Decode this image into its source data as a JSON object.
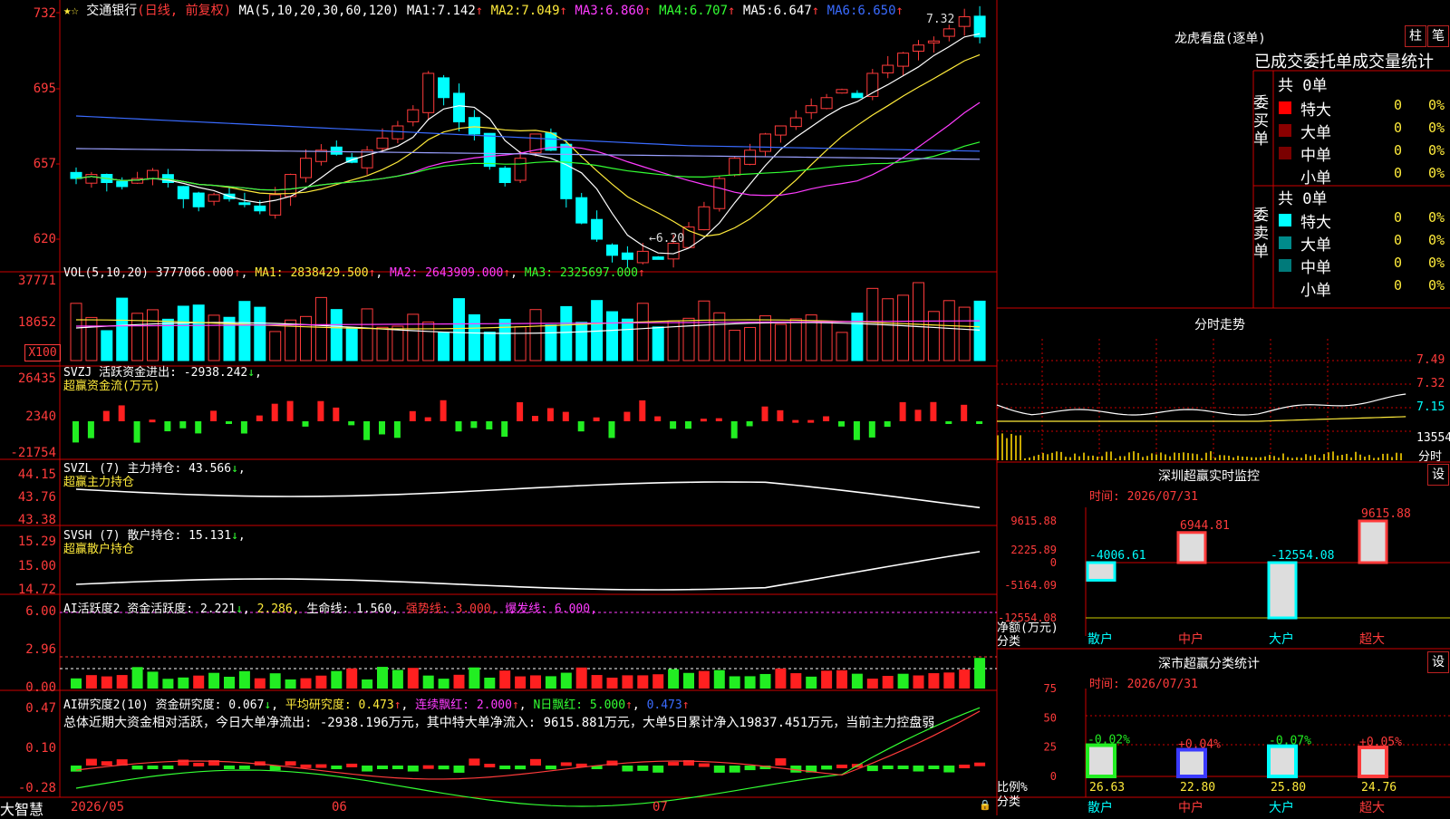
{
  "stock": {
    "name": "交通银行",
    "mode": "(日线, 前复权)"
  },
  "main": {
    "y_ticks": [
      "732",
      "695",
      "657",
      "620"
    ],
    "ma_label": "MA(5,10,20,30,60,120)",
    "ma_values": [
      {
        "label": "MA1:",
        "value": "7.142",
        "arrow": "↑"
      },
      {
        "label": "MA2:",
        "value": "7.049",
        "arrow": "↑"
      },
      {
        "label": "MA3:",
        "value": "6.860",
        "arrow": "↑"
      },
      {
        "label": "MA4:",
        "value": "6.707",
        "arrow": "↑"
      },
      {
        "label": "MA5:",
        "value": "6.647",
        "arrow": "↑"
      },
      {
        "label": "MA6:",
        "value": "6.650",
        "arrow": "↑"
      }
    ],
    "high_label": "7.32",
    "low_label": "←6.20"
  },
  "vol": {
    "y_ticks": [
      "37771",
      "18652"
    ],
    "unit": "X100",
    "label": "VOL(5,10,20)",
    "value": "3777066.000",
    "ma1": "MA1: 2838429.500",
    "ma2": "MA2: 2643909.000",
    "ma3": "MA3: 2325697.000"
  },
  "svzj": {
    "y_ticks": [
      "26435",
      "2340",
      "-21754"
    ],
    "line1": "SVZJ  活跃资金进出: -2938.242",
    "line2": "超赢资金流(万元)"
  },
  "svzl": {
    "y_ticks": [
      "44.15",
      "43.76",
      "43.38"
    ],
    "line1": "SVZL (7) 主力持仓: 43.566",
    "line2": "超赢主力持仓"
  },
  "svsh": {
    "y_ticks": [
      "15.29",
      "15.00",
      "14.72"
    ],
    "line1": "SVSH (7) 散户持仓: 15.131",
    "line2": "超赢散户持仓"
  },
  "ai_active": {
    "y_ticks": [
      "6.00",
      "2.96",
      "0.00"
    ],
    "label": "AI活跃度2 资金活跃度: 2.221",
    "v2": "2.286,",
    "life": "生命线: 1.560,",
    "strong": "强势线: 3.000,",
    "burst": "爆发线: 6.000,"
  },
  "ai_research": {
    "y_ticks": [
      "0.47",
      "0.10",
      "-0.28"
    ],
    "label": "AI研究度2(10) 资金研究度: 0.067",
    "avg": "平均研究度: 0.473",
    "lianxu": "连续飘红: 2.000",
    "nday": "N日飘红: 5.000",
    "last": "0.473",
    "summary": "总体近期大资金相对活跃，今日大单净流出: -2938.196万元，其中特大单净流入: 9615.881万元，大单5日累计净入19837.451万元，当前主力控盘弱"
  },
  "bottom": {
    "brand": "大智慧",
    "dates": [
      "2026/05",
      "06",
      "07"
    ]
  },
  "right": {
    "header_title": "龙虎看盘(逐单)",
    "btn_zhu": "柱",
    "btn_bi": "笔",
    "table_title": "已成交委托单成交量统计",
    "buy": {
      "side": "委买单",
      "total": "共 0单",
      "rows": [
        {
          "name": "特大",
          "v": "0",
          "p": "0%",
          "color": "#ff0000"
        },
        {
          "name": "大单",
          "v": "0",
          "p": "0%",
          "color": "#8b0000"
        },
        {
          "name": "中单",
          "v": "0",
          "p": "0%",
          "color": "#7a0000"
        },
        {
          "name": "小单",
          "v": "0",
          "p": "0%",
          "color": ""
        }
      ]
    },
    "sell": {
      "side": "委卖单",
      "total": "共 0单",
      "rows": [
        {
          "name": "特大",
          "v": "0",
          "p": "0%",
          "color": "#00ffff"
        },
        {
          "name": "大单",
          "v": "0",
          "p": "0%",
          "color": "#008b8b"
        },
        {
          "name": "中单",
          "v": "0",
          "p": "0%",
          "color": "#007a7a"
        },
        {
          "name": "小单",
          "v": "0",
          "p": "0%",
          "color": ""
        }
      ]
    },
    "fenshi": {
      "title": "分时走势",
      "y_ticks": [
        "7.49",
        "7.32",
        "7.15",
        "13554"
      ],
      "x_unit": "分时"
    },
    "monitor": {
      "title": "深圳超赢实时监控",
      "btn": "设",
      "time": "时间: 2026/07/31",
      "y_ticks": [
        "9615.88",
        "2225.89",
        "0",
        "-5164.09",
        "-12554.08"
      ],
      "label_net": "净额(万元)",
      "label_cat": "分类",
      "bars": [
        {
          "cat": "散户",
          "value": -4006.61,
          "label": "-4006.61"
        },
        {
          "cat": "中户",
          "value": 6944.81,
          "label": "6944.81"
        },
        {
          "cat": "大户",
          "value": -12554.08,
          "label": "-12554.08"
        },
        {
          "cat": "超大",
          "value": 9615.88,
          "label": "9615.88"
        }
      ]
    },
    "stats": {
      "title": "深市超赢分类统计",
      "btn": "设",
      "time": "时间: 2026/07/31",
      "y_ticks": [
        "75",
        "50",
        "25",
        "0"
      ],
      "label_ratio": "比例%",
      "label_cat": "分类",
      "bars": [
        {
          "cat": "散户",
          "value": 26.63,
          "change": "-0.02%"
        },
        {
          "cat": "中户",
          "value": 22.8,
          "change": "+0.04%"
        },
        {
          "cat": "大户",
          "value": 25.8,
          "change": "-0.07%"
        },
        {
          "cat": "超大",
          "value": 24.76,
          "change": "+0.05%"
        }
      ]
    }
  },
  "colors": {
    "up": "#ff3b3b",
    "down": "#00ffff",
    "grid": "#cc0000"
  }
}
